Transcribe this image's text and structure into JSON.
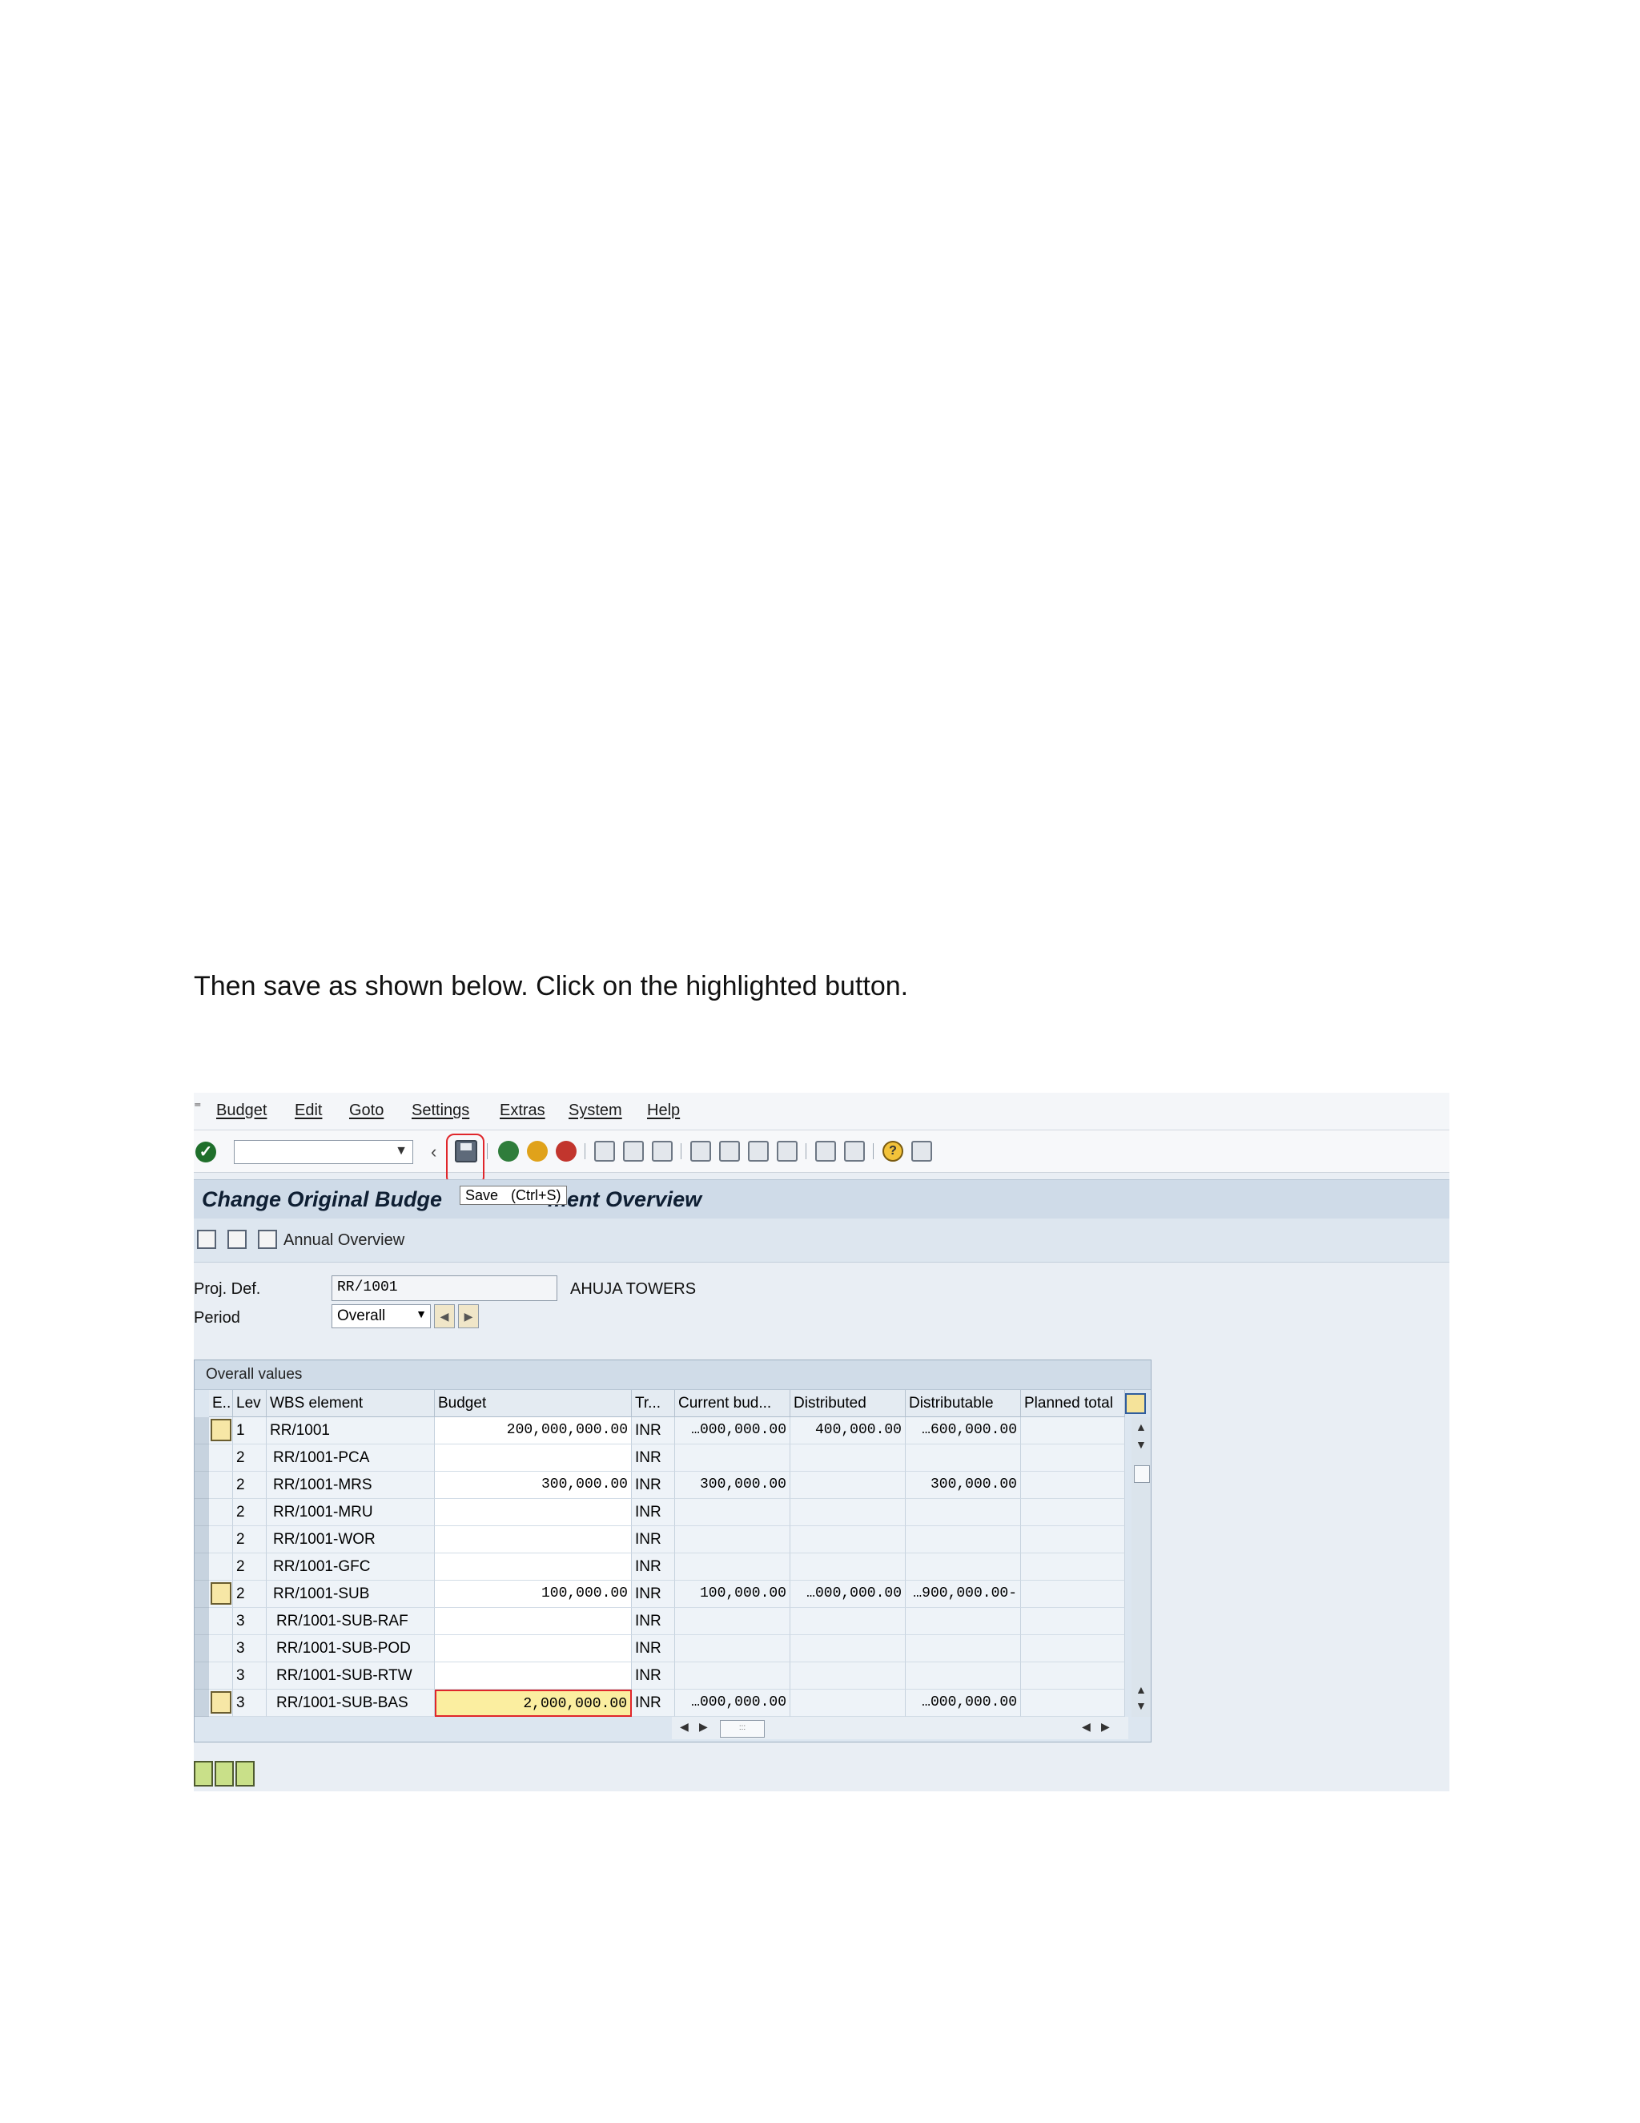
{
  "instruction": "Then save as shown below. Click on the highlighted button.",
  "menu": {
    "items": [
      "Budget",
      "Edit",
      "Goto",
      "Settings",
      "Extras",
      "System",
      "Help"
    ]
  },
  "toolbar": {
    "command_field_value": "",
    "save_tooltip": "Save",
    "save_shortcut": "(Ctrl+S)"
  },
  "title": {
    "left": "Change Original Budge",
    "right": "ment Overview"
  },
  "app_toolbar": {
    "annual_overview": "Annual Overview"
  },
  "form": {
    "proj_def_label": "Proj. Def.",
    "proj_def_value": "RR/1001",
    "proj_def_desc": "AHUJA TOWERS",
    "period_label": "Period",
    "period_value": "Overall"
  },
  "table": {
    "title": "Overall values",
    "columns": [
      "E..",
      "Lev",
      "WBS element",
      "Budget",
      "Tr...",
      "Current bud...",
      "Distributed",
      "Distributable",
      "Planned total"
    ],
    "rows": [
      {
        "lev": "1",
        "wbs": "RR/1001",
        "budget": "200,000,000.00",
        "tr": "INR",
        "current": "…000,000.00",
        "distributed": "400,000.00",
        "distributable": "…600,000.00",
        "planned": "",
        "hier": true
      },
      {
        "lev": "2",
        "wbs": "RR/1001-PCA",
        "budget": "",
        "tr": "INR",
        "current": "",
        "distributed": "",
        "distributable": "",
        "planned": "",
        "hier": false
      },
      {
        "lev": "2",
        "wbs": "RR/1001-MRS",
        "budget": "300,000.00",
        "tr": "INR",
        "current": "300,000.00",
        "distributed": "",
        "distributable": "300,000.00",
        "planned": "",
        "hier": false
      },
      {
        "lev": "2",
        "wbs": "RR/1001-MRU",
        "budget": "",
        "tr": "INR",
        "current": "",
        "distributed": "",
        "distributable": "",
        "planned": "",
        "hier": false
      },
      {
        "lev": "2",
        "wbs": "RR/1001-WOR",
        "budget": "",
        "tr": "INR",
        "current": "",
        "distributed": "",
        "distributable": "",
        "planned": "",
        "hier": false
      },
      {
        "lev": "2",
        "wbs": "RR/1001-GFC",
        "budget": "",
        "tr": "INR",
        "current": "",
        "distributed": "",
        "distributable": "",
        "planned": "",
        "hier": false
      },
      {
        "lev": "2",
        "wbs": "RR/1001-SUB",
        "budget": "100,000.00",
        "tr": "INR",
        "current": "100,000.00",
        "distributed": "…000,000.00",
        "distributable": "…900,000.00-",
        "planned": "",
        "hier": true
      },
      {
        "lev": "3",
        "wbs": "RR/1001-SUB-RAF",
        "budget": "",
        "tr": "INR",
        "current": "",
        "distributed": "",
        "distributable": "",
        "planned": "",
        "hier": false
      },
      {
        "lev": "3",
        "wbs": "RR/1001-SUB-POD",
        "budget": "",
        "tr": "INR",
        "current": "",
        "distributed": "",
        "distributable": "",
        "planned": "",
        "hier": false
      },
      {
        "lev": "3",
        "wbs": "RR/1001-SUB-RTW",
        "budget": "",
        "tr": "INR",
        "current": "",
        "distributed": "",
        "distributable": "",
        "planned": "",
        "hier": false
      },
      {
        "lev": "3",
        "wbs": "RR/1001-SUB-BAS",
        "budget": "2,000,000.00",
        "tr": "INR",
        "current": "…000,000.00",
        "distributed": "",
        "distributable": "…000,000.00",
        "planned": "",
        "hier": true,
        "editing": true
      }
    ]
  },
  "colors": {
    "highlight": "#e0262b",
    "title_bar": "#cfdbe8",
    "edit_cell": "#fbeea0"
  }
}
